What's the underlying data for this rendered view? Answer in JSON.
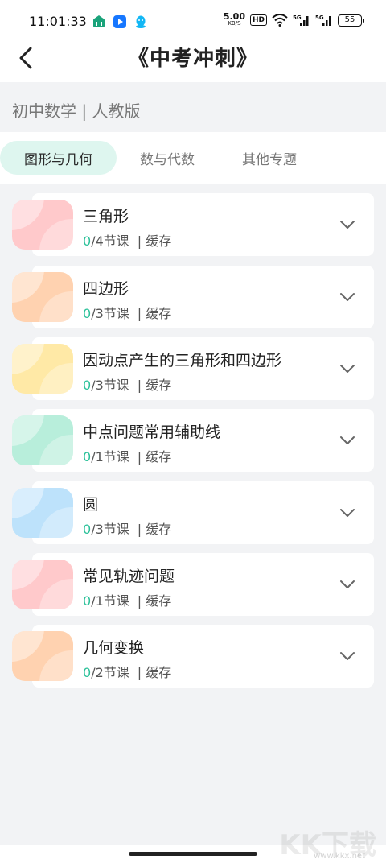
{
  "status_bar": {
    "time": "11:01:33",
    "net_speed_value": "5.00",
    "net_speed_unit": "KB/S",
    "hd": "HD",
    "signal_1": "5G",
    "signal_2": "5G",
    "battery": "55",
    "app_icons": [
      "bank-app-icon",
      "play-app-icon",
      "qq-app-icon"
    ]
  },
  "header": {
    "title": "《中考冲刺》"
  },
  "subject": {
    "label": "初中数学 | 人教版"
  },
  "tabs": [
    {
      "label": "图形与几何",
      "active": true
    },
    {
      "label": "数与代数",
      "active": false
    },
    {
      "label": "其他专题",
      "active": false
    }
  ],
  "courses": [
    {
      "title": "三角形",
      "done": "0",
      "total": "/4节课",
      "cache": "| 缓存",
      "color": "#ffc9cb"
    },
    {
      "title": "四边形",
      "done": "0",
      "total": "/3节课",
      "cache": "| 缓存",
      "color": "#ffd2b0"
    },
    {
      "title": "因动点产生的三角形和四边形",
      "done": "0",
      "total": "/3节课",
      "cache": "| 缓存",
      "color": "#ffe9a6"
    },
    {
      "title": "中点问题常用辅助线",
      "done": "0",
      "total": "/1节课",
      "cache": "| 缓存",
      "color": "#b8eedb"
    },
    {
      "title": "圆",
      "done": "0",
      "total": "/3节课",
      "cache": "| 缓存",
      "color": "#bde2fb"
    },
    {
      "title": "常见轨迹问题",
      "done": "0",
      "total": "/1节课",
      "cache": "| 缓存",
      "color": "#ffc9cb"
    },
    {
      "title": "几何变换",
      "done": "0",
      "total": "/2节课",
      "cache": "| 缓存",
      "color": "#ffd2b0"
    }
  ],
  "colors": {
    "accent": "#2cc19a",
    "active_tab_bg": "#def6ef",
    "page_bg": "#f2f3f5"
  },
  "watermark": {
    "logo": "KK下载",
    "url": "www.kkx.net"
  }
}
